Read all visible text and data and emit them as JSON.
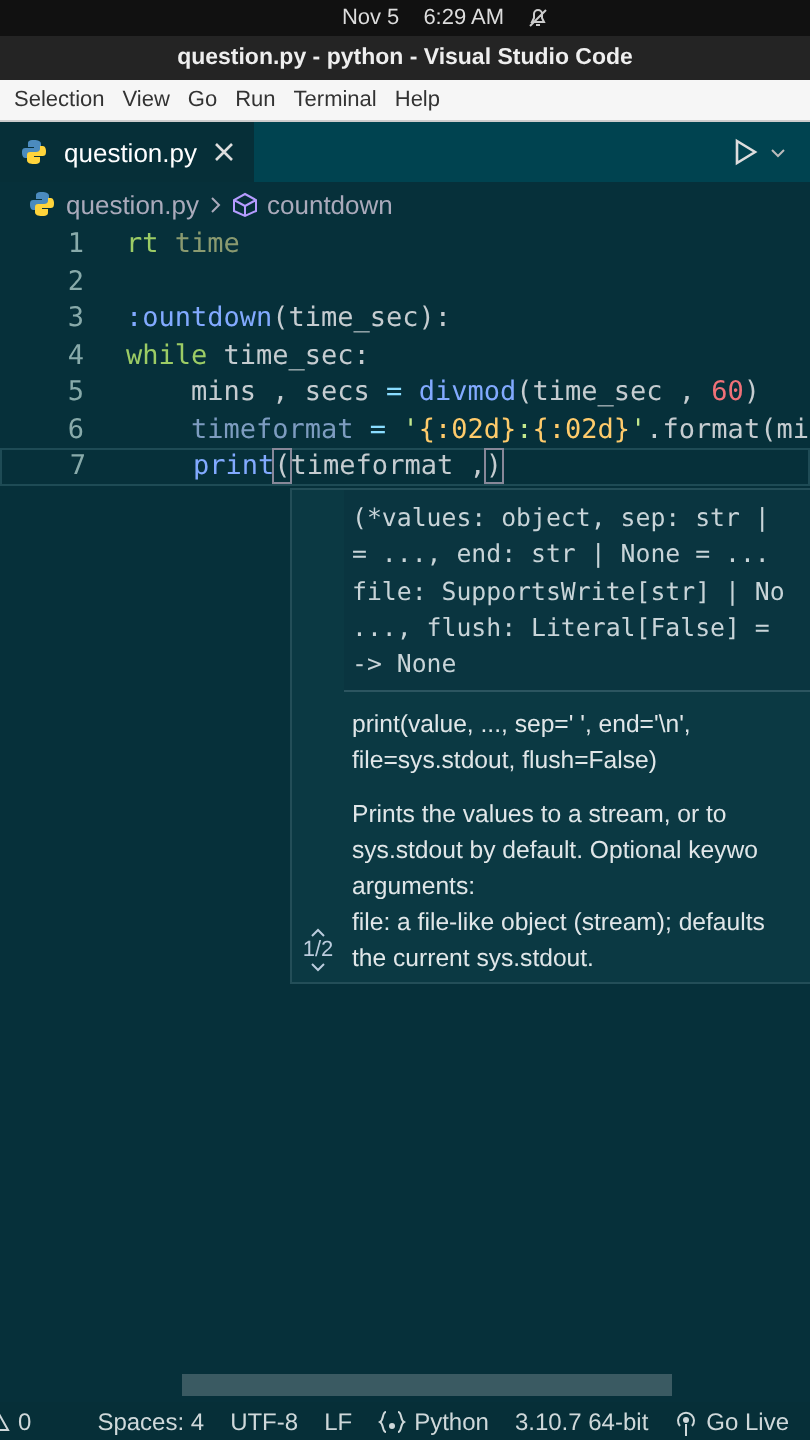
{
  "system_bar": {
    "date": "Nov 5",
    "time": "6:29 AM"
  },
  "window": {
    "title": "question.py - python - Visual Studio Code"
  },
  "menu": [
    "Selection",
    "View",
    "Go",
    "Run",
    "Terminal",
    "Help"
  ],
  "tabs": [
    {
      "label": "question.py",
      "selected": true
    }
  ],
  "breadcrumb": {
    "file": "question.py",
    "symbol": "countdown"
  },
  "code_lines": [
    {
      "number": "1",
      "current": false,
      "tokens": [
        {
          "kind": "kw",
          "text": "rt"
        },
        {
          "kind": "module",
          "text": " time"
        }
      ]
    },
    {
      "number": "2",
      "current": false
    },
    {
      "number": "3",
      "current": false,
      "tokens": [
        {
          "kind": "name",
          "text": ":ountdown"
        },
        {
          "kind": "plain",
          "text": "(time_sec):"
        }
      ]
    },
    {
      "number": "4",
      "current": false,
      "tokens": [
        {
          "kind": "kw",
          "text": "while"
        },
        {
          "kind": "plain",
          "text": " time_sec:"
        }
      ]
    },
    {
      "number": "5",
      "current": false,
      "tokens": [
        {
          "kind": "plain",
          "text": "    mins , secs "
        },
        {
          "kind": "op",
          "text": "="
        },
        {
          "kind": "fn",
          "text": " divmod"
        },
        {
          "kind": "plain",
          "text": "(time_sec , "
        },
        {
          "kind": "num",
          "text": "60"
        },
        {
          "kind": "plain",
          "text": ")"
        }
      ]
    },
    {
      "number": "6",
      "current": false,
      "tokens": [
        {
          "kind": "var",
          "text": "    timeformat"
        },
        {
          "kind": "op",
          "text": " = "
        },
        {
          "kind": "str",
          "text": "'"
        },
        {
          "kind": "brace",
          "text": "{:02d}"
        },
        {
          "kind": "str",
          "text": ":"
        },
        {
          "kind": "brace",
          "text": "{:02d}"
        },
        {
          "kind": "str",
          "text": "'"
        },
        {
          "kind": "plain",
          "text": ".format(mi"
        }
      ]
    },
    {
      "number": "7",
      "current": true,
      "tokens": [
        {
          "kind": "fn",
          "text": "    print"
        },
        {
          "kind": "match",
          "text": "("
        },
        {
          "kind": "plain",
          "text": "timeformat ,"
        },
        {
          "kind": "match",
          "text": ")"
        }
      ]
    }
  ],
  "hover": {
    "signature": [
      "(*values: object, sep: str |",
      "= ..., end: str | None = ...",
      "file: SupportsWrite[str] | No",
      "..., flush: Literal[False] =",
      "-> None"
    ],
    "doc_signature": [
      "print(value, ..., sep=' ', end='\\n',",
      "file=sys.stdout, flush=False)"
    ],
    "description": [
      "Prints the values to a stream, or to",
      "sys.stdout by default. Optional keywo",
      "arguments:",
      "file: a file-like object (stream); defaults",
      "the current sys.stdout."
    ],
    "overload": "1/2"
  },
  "status_bar": [
    {
      "kind": "warnings",
      "text": "0"
    },
    {
      "kind": "text",
      "text": "Spaces: 4"
    },
    {
      "kind": "text",
      "text": "UTF-8"
    },
    {
      "kind": "text",
      "text": "LF"
    },
    {
      "kind": "language",
      "text": "Python"
    },
    {
      "kind": "text",
      "text": "3.10.7 64-bit"
    },
    {
      "kind": "live",
      "text": "Go Live"
    }
  ]
}
